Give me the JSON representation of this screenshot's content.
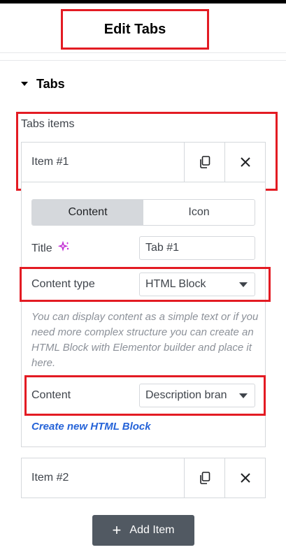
{
  "header": {
    "title": "Edit Tabs"
  },
  "section": {
    "title": "Tabs"
  },
  "repeater": {
    "label": "Tabs items",
    "items": [
      {
        "title": "Item #1"
      },
      {
        "title": "Item #2"
      }
    ],
    "add_label": "Add Item"
  },
  "item_editor": {
    "tabs": [
      "Content",
      "Icon"
    ],
    "active_tab": "Content",
    "title_label": "Title",
    "title_value": "Tab #1",
    "content_type_label": "Content type",
    "content_type_value": "HTML Block",
    "description": "You can display content as a simple text or if you need more complex structure you can create an HTML Block with Elementor builder and place it here.",
    "content_label": "Content",
    "content_value": "Description bran",
    "create_link": "Create new HTML Block"
  },
  "colors": {
    "highlight": "#e31b23",
    "button": "#515962",
    "link": "#2563d8",
    "ai_icon": "#c026d3"
  },
  "icons": [
    "caret-down-icon",
    "copy-icon",
    "close-icon",
    "sparkle-icon",
    "select-caret-icon",
    "plus-icon"
  ]
}
